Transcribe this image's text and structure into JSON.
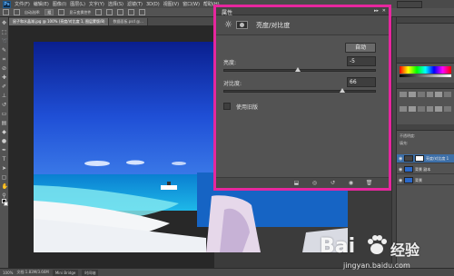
{
  "app": {
    "logo": "Ps"
  },
  "menubar": {
    "items": [
      "文件(F)",
      "编辑(E)",
      "图像(I)",
      "图层(L)",
      "文字(Y)",
      "选择(S)",
      "滤镜(T)",
      "3D(D)",
      "视图(V)",
      "窗口(W)",
      "帮助(H)"
    ]
  },
  "optionsbar": {
    "auto_select": "自动选择:",
    "group": "组",
    "transform": "显示变换控件"
  },
  "document": {
    "tabs": [
      "鼠子和水晶湖.jpg @ 100% (亮度/对比度 1, 图层蒙版/8)",
      "数据面板.psd @..."
    ]
  },
  "status": {
    "zoom": "100%",
    "doc_size": "文档:1.83M/3.66M",
    "tab_minibridge": "Mini Bridge",
    "tab_timeline": "时间轴"
  },
  "properties_panel": {
    "title": "属性",
    "collapse": "▸▸",
    "close": "✕",
    "heading": "亮度/对比度",
    "auto_button": "自动",
    "brightness": {
      "label": "亮度:",
      "value": "-5",
      "min": -150,
      "max": 150,
      "level": -5
    },
    "contrast": {
      "label": "对比度:",
      "value": "66",
      "min": -50,
      "max": 100,
      "level": 66
    },
    "legacy_label": "使用旧版"
  },
  "right_panels": {
    "adjust_label": "不透明度:",
    "fill_label": "填充:",
    "layers": [
      {
        "name": "亮度/对比度 1",
        "selected": true
      },
      {
        "name": "背景 副本",
        "selected": false
      },
      {
        "name": "背景",
        "selected": false
      }
    ]
  },
  "watermark": {
    "brand": "Bai",
    "suffix": "经验",
    "url": "jingyan.baidu.com"
  },
  "colors": {
    "highlight": "#e6279e",
    "panel": "#535353",
    "selection": "#3d6fa8"
  }
}
